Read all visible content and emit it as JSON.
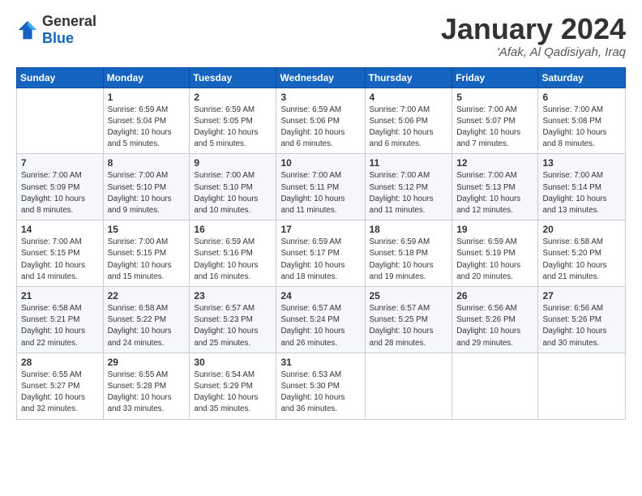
{
  "header": {
    "logo_general": "General",
    "logo_blue": "Blue",
    "month_title": "January 2024",
    "subtitle": "'Afak, Al Qadisiyah, Iraq"
  },
  "days_of_week": [
    "Sunday",
    "Monday",
    "Tuesday",
    "Wednesday",
    "Thursday",
    "Friday",
    "Saturday"
  ],
  "weeks": [
    [
      {
        "day": "",
        "info": ""
      },
      {
        "day": "1",
        "info": "Sunrise: 6:59 AM\nSunset: 5:04 PM\nDaylight: 10 hours\nand 5 minutes."
      },
      {
        "day": "2",
        "info": "Sunrise: 6:59 AM\nSunset: 5:05 PM\nDaylight: 10 hours\nand 5 minutes."
      },
      {
        "day": "3",
        "info": "Sunrise: 6:59 AM\nSunset: 5:06 PM\nDaylight: 10 hours\nand 6 minutes."
      },
      {
        "day": "4",
        "info": "Sunrise: 7:00 AM\nSunset: 5:06 PM\nDaylight: 10 hours\nand 6 minutes."
      },
      {
        "day": "5",
        "info": "Sunrise: 7:00 AM\nSunset: 5:07 PM\nDaylight: 10 hours\nand 7 minutes."
      },
      {
        "day": "6",
        "info": "Sunrise: 7:00 AM\nSunset: 5:08 PM\nDaylight: 10 hours\nand 8 minutes."
      }
    ],
    [
      {
        "day": "7",
        "info": "Sunrise: 7:00 AM\nSunset: 5:09 PM\nDaylight: 10 hours\nand 8 minutes."
      },
      {
        "day": "8",
        "info": "Sunrise: 7:00 AM\nSunset: 5:10 PM\nDaylight: 10 hours\nand 9 minutes."
      },
      {
        "day": "9",
        "info": "Sunrise: 7:00 AM\nSunset: 5:10 PM\nDaylight: 10 hours\nand 10 minutes."
      },
      {
        "day": "10",
        "info": "Sunrise: 7:00 AM\nSunset: 5:11 PM\nDaylight: 10 hours\nand 11 minutes."
      },
      {
        "day": "11",
        "info": "Sunrise: 7:00 AM\nSunset: 5:12 PM\nDaylight: 10 hours\nand 11 minutes."
      },
      {
        "day": "12",
        "info": "Sunrise: 7:00 AM\nSunset: 5:13 PM\nDaylight: 10 hours\nand 12 minutes."
      },
      {
        "day": "13",
        "info": "Sunrise: 7:00 AM\nSunset: 5:14 PM\nDaylight: 10 hours\nand 13 minutes."
      }
    ],
    [
      {
        "day": "14",
        "info": "Sunrise: 7:00 AM\nSunset: 5:15 PM\nDaylight: 10 hours\nand 14 minutes."
      },
      {
        "day": "15",
        "info": "Sunrise: 7:00 AM\nSunset: 5:15 PM\nDaylight: 10 hours\nand 15 minutes."
      },
      {
        "day": "16",
        "info": "Sunrise: 6:59 AM\nSunset: 5:16 PM\nDaylight: 10 hours\nand 16 minutes."
      },
      {
        "day": "17",
        "info": "Sunrise: 6:59 AM\nSunset: 5:17 PM\nDaylight: 10 hours\nand 18 minutes."
      },
      {
        "day": "18",
        "info": "Sunrise: 6:59 AM\nSunset: 5:18 PM\nDaylight: 10 hours\nand 19 minutes."
      },
      {
        "day": "19",
        "info": "Sunrise: 6:59 AM\nSunset: 5:19 PM\nDaylight: 10 hours\nand 20 minutes."
      },
      {
        "day": "20",
        "info": "Sunrise: 6:58 AM\nSunset: 5:20 PM\nDaylight: 10 hours\nand 21 minutes."
      }
    ],
    [
      {
        "day": "21",
        "info": "Sunrise: 6:58 AM\nSunset: 5:21 PM\nDaylight: 10 hours\nand 22 minutes."
      },
      {
        "day": "22",
        "info": "Sunrise: 6:58 AM\nSunset: 5:22 PM\nDaylight: 10 hours\nand 24 minutes."
      },
      {
        "day": "23",
        "info": "Sunrise: 6:57 AM\nSunset: 5:23 PM\nDaylight: 10 hours\nand 25 minutes."
      },
      {
        "day": "24",
        "info": "Sunrise: 6:57 AM\nSunset: 5:24 PM\nDaylight: 10 hours\nand 26 minutes."
      },
      {
        "day": "25",
        "info": "Sunrise: 6:57 AM\nSunset: 5:25 PM\nDaylight: 10 hours\nand 28 minutes."
      },
      {
        "day": "26",
        "info": "Sunrise: 6:56 AM\nSunset: 5:26 PM\nDaylight: 10 hours\nand 29 minutes."
      },
      {
        "day": "27",
        "info": "Sunrise: 6:56 AM\nSunset: 5:26 PM\nDaylight: 10 hours\nand 30 minutes."
      }
    ],
    [
      {
        "day": "28",
        "info": "Sunrise: 6:55 AM\nSunset: 5:27 PM\nDaylight: 10 hours\nand 32 minutes."
      },
      {
        "day": "29",
        "info": "Sunrise: 6:55 AM\nSunset: 5:28 PM\nDaylight: 10 hours\nand 33 minutes."
      },
      {
        "day": "30",
        "info": "Sunrise: 6:54 AM\nSunset: 5:29 PM\nDaylight: 10 hours\nand 35 minutes."
      },
      {
        "day": "31",
        "info": "Sunrise: 6:53 AM\nSunset: 5:30 PM\nDaylight: 10 hours\nand 36 minutes."
      },
      {
        "day": "",
        "info": ""
      },
      {
        "day": "",
        "info": ""
      },
      {
        "day": "",
        "info": ""
      }
    ]
  ]
}
